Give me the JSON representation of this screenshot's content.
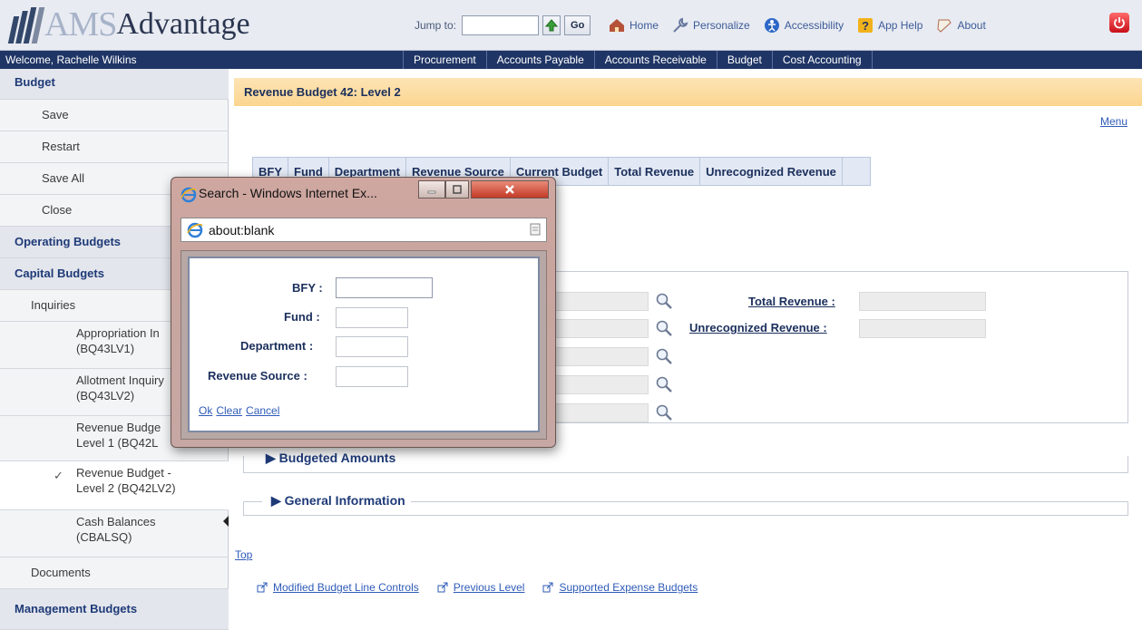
{
  "header": {
    "logo_am": "AMS",
    "logo_advantage": "Advantage",
    "jump_label": "Jump to:",
    "jump_value": "",
    "go_label": "Go",
    "links": [
      {
        "label": "Home",
        "icon": "home-icon"
      },
      {
        "label": "Personalize",
        "icon": "wrench-icon"
      },
      {
        "label": "Accessibility",
        "icon": "accessibility-icon"
      },
      {
        "label": "App Help",
        "icon": "help-icon"
      },
      {
        "label": "About",
        "icon": "about-icon"
      }
    ]
  },
  "navbar": {
    "welcome": "Welcome, Rachelle Wilkins",
    "items": [
      "Procurement",
      "Accounts Payable",
      "Accounts Receivable",
      "Budget",
      "Cost Accounting"
    ]
  },
  "sidebar": {
    "budget": "Budget",
    "save": "Save",
    "restart": "Restart",
    "save_all": "Save All",
    "close": "Close",
    "operating_budgets": "Operating Budgets",
    "capital_budgets": "Capital Budgets",
    "inquiries": "Inquiries",
    "approp_1": "Appropriation In",
    "approp_2": "(BQ43LV1)",
    "allot_1": "Allotment Inquiry",
    "allot_2": "(BQ43LV2)",
    "revl1_1": "Revenue Budge",
    "revl1_2": "Level 1 (BQ42L",
    "revl2_1": "Revenue Budget -",
    "revl2_2": "Level 2 (BQ42LV2)",
    "cash_1": "Cash Balances",
    "cash_2": "(CBALSQ)",
    "documents": "Documents",
    "management_budgets": "Management Budgets"
  },
  "main": {
    "title": "Revenue Budget 42: Level 2",
    "menu": "Menu",
    "grid_headers": [
      "BFY",
      "Fund",
      "Department",
      "Revenue Source",
      "Current Budget",
      "Total Revenue",
      "Unrecognized Revenue",
      ""
    ],
    "total_revenue_label": "Total Revenue :",
    "unrecognized_revenue_label": "Unrecognized Revenue :",
    "budgeted_amounts": "Budgeted Amounts",
    "general_information": "General Information",
    "top": "Top",
    "bottom_links": [
      "Modified Budget Line Controls",
      "Previous Level",
      "Supported Expense Budgets"
    ]
  },
  "popup": {
    "title": "Search - Windows Internet Ex...",
    "address": "about:blank",
    "labels": {
      "bfy": "BFY :",
      "fund": "Fund :",
      "department": "Department :",
      "revenue_source": "Revenue Source :"
    },
    "values": {
      "bfy": "",
      "fund": "",
      "department": "",
      "revenue_source": ""
    },
    "ok": "Ok",
    "clear": "Clear",
    "cancel": "Cancel"
  },
  "colors": {
    "nav_bg": "#1f3565",
    "title_bar": "#fbd58f",
    "link": "#2f5bb7",
    "label": "#1b2f5c"
  }
}
